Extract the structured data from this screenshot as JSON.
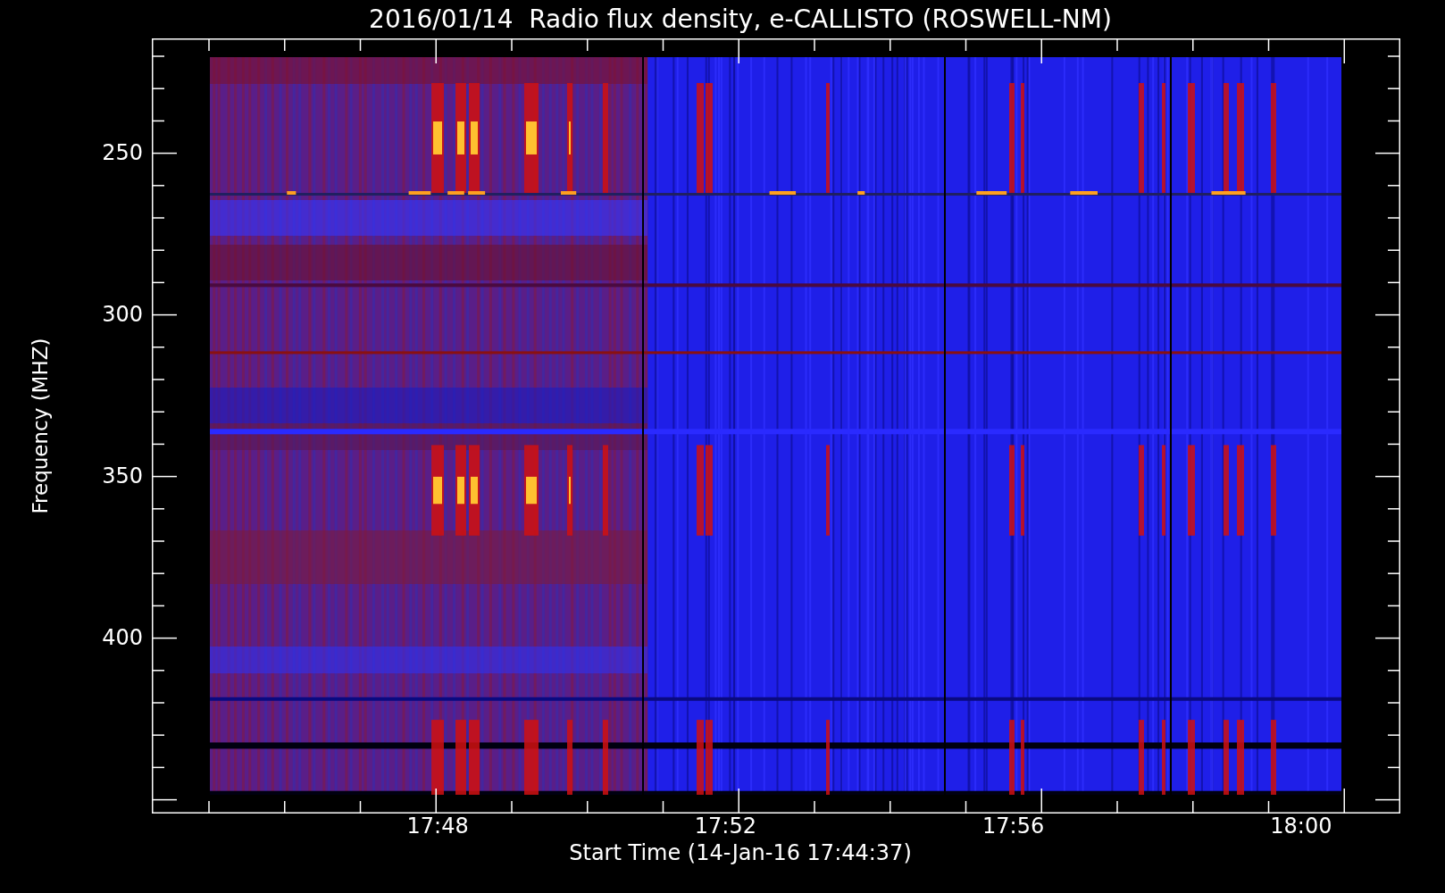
{
  "title": "2016/01/14  Radio flux density, e-CALLISTO (ROSWELL-NM)",
  "y_axis": {
    "title": "Frequency (MHZ)",
    "ticks": [
      "250",
      "300",
      "350",
      "400"
    ]
  },
  "x_axis": {
    "title": "Start Time (14-Jan-16 17:44:37)",
    "ticks": [
      "17:48",
      "17:52",
      "17:56",
      "18:00"
    ]
  }
}
